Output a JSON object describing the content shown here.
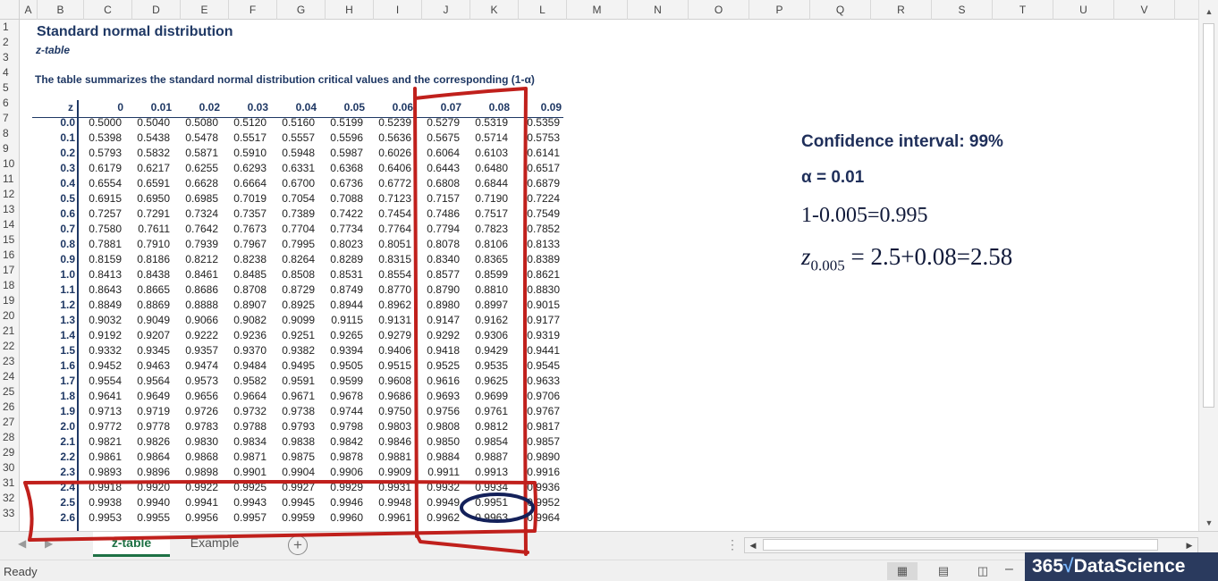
{
  "columns": [
    "A",
    "B",
    "C",
    "D",
    "E",
    "F",
    "G",
    "H",
    "I",
    "J",
    "K",
    "L",
    "M",
    "N",
    "O",
    "P",
    "Q",
    "R",
    "S",
    "T",
    "U",
    "V"
  ],
  "rows": [
    "1",
    "2",
    "3",
    "4",
    "5",
    "6",
    "7",
    "8",
    "9",
    "10",
    "11",
    "12",
    "13",
    "14",
    "15",
    "16",
    "17",
    "18",
    "19",
    "20",
    "21",
    "22",
    "23",
    "24",
    "25",
    "26",
    "27",
    "28",
    "29",
    "30",
    "31",
    "32",
    "33"
  ],
  "sheet": {
    "title": "Standard normal distribution",
    "subtitle": "z-table",
    "description": "The table summarizes the standard normal distribution critical values and the corresponding (1-α)"
  },
  "table": {
    "z_header": "z",
    "col_headers": [
      "0",
      "0.01",
      "0.02",
      "0.03",
      "0.04",
      "0.05",
      "0.06",
      "0.07",
      "0.08",
      "0.09"
    ],
    "z_values": [
      "0.0",
      "0.1",
      "0.2",
      "0.3",
      "0.4",
      "0.5",
      "0.6",
      "0.7",
      "0.8",
      "0.9",
      "1.0",
      "1.1",
      "1.2",
      "1.3",
      "1.4",
      "1.5",
      "1.6",
      "1.7",
      "1.8",
      "1.9",
      "2.0",
      "2.1",
      "2.2",
      "2.3",
      "2.4",
      "2.5",
      "2.6"
    ],
    "rows": [
      [
        "0.5000",
        "0.5040",
        "0.5080",
        "0.5120",
        "0.5160",
        "0.5199",
        "0.5239",
        "0.5279",
        "0.5319",
        "0.5359"
      ],
      [
        "0.5398",
        "0.5438",
        "0.5478",
        "0.5517",
        "0.5557",
        "0.5596",
        "0.5636",
        "0.5675",
        "0.5714",
        "0.5753"
      ],
      [
        "0.5793",
        "0.5832",
        "0.5871",
        "0.5910",
        "0.5948",
        "0.5987",
        "0.6026",
        "0.6064",
        "0.6103",
        "0.6141"
      ],
      [
        "0.6179",
        "0.6217",
        "0.6255",
        "0.6293",
        "0.6331",
        "0.6368",
        "0.6406",
        "0.6443",
        "0.6480",
        "0.6517"
      ],
      [
        "0.6554",
        "0.6591",
        "0.6628",
        "0.6664",
        "0.6700",
        "0.6736",
        "0.6772",
        "0.6808",
        "0.6844",
        "0.6879"
      ],
      [
        "0.6915",
        "0.6950",
        "0.6985",
        "0.7019",
        "0.7054",
        "0.7088",
        "0.7123",
        "0.7157",
        "0.7190",
        "0.7224"
      ],
      [
        "0.7257",
        "0.7291",
        "0.7324",
        "0.7357",
        "0.7389",
        "0.7422",
        "0.7454",
        "0.7486",
        "0.7517",
        "0.7549"
      ],
      [
        "0.7580",
        "0.7611",
        "0.7642",
        "0.7673",
        "0.7704",
        "0.7734",
        "0.7764",
        "0.7794",
        "0.7823",
        "0.7852"
      ],
      [
        "0.7881",
        "0.7910",
        "0.7939",
        "0.7967",
        "0.7995",
        "0.8023",
        "0.8051",
        "0.8078",
        "0.8106",
        "0.8133"
      ],
      [
        "0.8159",
        "0.8186",
        "0.8212",
        "0.8238",
        "0.8264",
        "0.8289",
        "0.8315",
        "0.8340",
        "0.8365",
        "0.8389"
      ],
      [
        "0.8413",
        "0.8438",
        "0.8461",
        "0.8485",
        "0.8508",
        "0.8531",
        "0.8554",
        "0.8577",
        "0.8599",
        "0.8621"
      ],
      [
        "0.8643",
        "0.8665",
        "0.8686",
        "0.8708",
        "0.8729",
        "0.8749",
        "0.8770",
        "0.8790",
        "0.8810",
        "0.8830"
      ],
      [
        "0.8849",
        "0.8869",
        "0.8888",
        "0.8907",
        "0.8925",
        "0.8944",
        "0.8962",
        "0.8980",
        "0.8997",
        "0.9015"
      ],
      [
        "0.9032",
        "0.9049",
        "0.9066",
        "0.9082",
        "0.9099",
        "0.9115",
        "0.9131",
        "0.9147",
        "0.9162",
        "0.9177"
      ],
      [
        "0.9192",
        "0.9207",
        "0.9222",
        "0.9236",
        "0.9251",
        "0.9265",
        "0.9279",
        "0.9292",
        "0.9306",
        "0.9319"
      ],
      [
        "0.9332",
        "0.9345",
        "0.9357",
        "0.9370",
        "0.9382",
        "0.9394",
        "0.9406",
        "0.9418",
        "0.9429",
        "0.9441"
      ],
      [
        "0.9452",
        "0.9463",
        "0.9474",
        "0.9484",
        "0.9495",
        "0.9505",
        "0.9515",
        "0.9525",
        "0.9535",
        "0.9545"
      ],
      [
        "0.9554",
        "0.9564",
        "0.9573",
        "0.9582",
        "0.9591",
        "0.9599",
        "0.9608",
        "0.9616",
        "0.9625",
        "0.9633"
      ],
      [
        "0.9641",
        "0.9649",
        "0.9656",
        "0.9664",
        "0.9671",
        "0.9678",
        "0.9686",
        "0.9693",
        "0.9699",
        "0.9706"
      ],
      [
        "0.9713",
        "0.9719",
        "0.9726",
        "0.9732",
        "0.9738",
        "0.9744",
        "0.9750",
        "0.9756",
        "0.9761",
        "0.9767"
      ],
      [
        "0.9772",
        "0.9778",
        "0.9783",
        "0.9788",
        "0.9793",
        "0.9798",
        "0.9803",
        "0.9808",
        "0.9812",
        "0.9817"
      ],
      [
        "0.9821",
        "0.9826",
        "0.9830",
        "0.9834",
        "0.9838",
        "0.9842",
        "0.9846",
        "0.9850",
        "0.9854",
        "0.9857"
      ],
      [
        "0.9861",
        "0.9864",
        "0.9868",
        "0.9871",
        "0.9875",
        "0.9878",
        "0.9881",
        "0.9884",
        "0.9887",
        "0.9890"
      ],
      [
        "0.9893",
        "0.9896",
        "0.9898",
        "0.9901",
        "0.9904",
        "0.9906",
        "0.9909",
        "0.9911",
        "0.9913",
        "0.9916"
      ],
      [
        "0.9918",
        "0.9920",
        "0.9922",
        "0.9925",
        "0.9927",
        "0.9929",
        "0.9931",
        "0.9932",
        "0.9934",
        "0.9936"
      ],
      [
        "0.9938",
        "0.9940",
        "0.9941",
        "0.9943",
        "0.9945",
        "0.9946",
        "0.9948",
        "0.9949",
        "0.9951",
        "0.9952"
      ],
      [
        "0.9953",
        "0.9955",
        "0.9956",
        "0.9957",
        "0.9959",
        "0.9960",
        "0.9961",
        "0.9962",
        "0.9963",
        "0.9964"
      ]
    ]
  },
  "notes": {
    "confidence": "Confidence interval: 99%",
    "alpha": "α = 0.01",
    "one_minus": "1-0.005=0.995",
    "z_symbol": "z",
    "z_subscript": "0.005",
    "z_result": " = 2.5+0.08=2.58"
  },
  "tabs": {
    "active": "z-table",
    "other": "Example",
    "add_symbol": "+"
  },
  "status": {
    "ready": "Ready"
  },
  "brand": {
    "prefix": "365",
    "root": "√",
    "name": "DataScience"
  },
  "colors": {
    "header_text": "#1f3864",
    "annotation_red": "#c0201c",
    "annotation_circle": "#14215a",
    "excel_green": "#1e7145"
  },
  "icons": {
    "view_normal": "grid-icon",
    "view_page_layout": "page-layout-icon",
    "view_page_break": "page-break-icon",
    "add_sheet": "plus-circle-icon"
  }
}
